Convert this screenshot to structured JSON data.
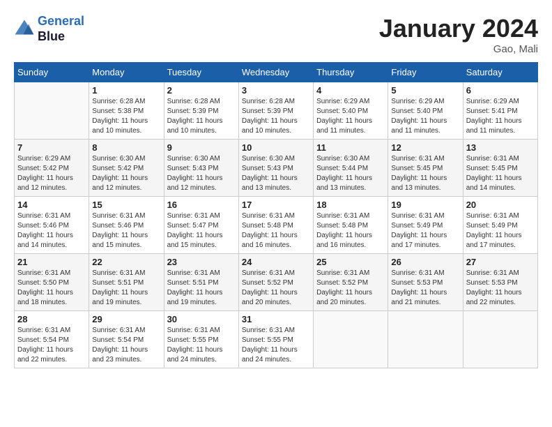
{
  "header": {
    "logo_line1": "General",
    "logo_line2": "Blue",
    "month_title": "January 2024",
    "location": "Gao, Mali"
  },
  "weekdays": [
    "Sunday",
    "Monday",
    "Tuesday",
    "Wednesday",
    "Thursday",
    "Friday",
    "Saturday"
  ],
  "weeks": [
    [
      {
        "day": "",
        "info": ""
      },
      {
        "day": "1",
        "info": "Sunrise: 6:28 AM\nSunset: 5:38 PM\nDaylight: 11 hours and 10 minutes."
      },
      {
        "day": "2",
        "info": "Sunrise: 6:28 AM\nSunset: 5:39 PM\nDaylight: 11 hours and 10 minutes."
      },
      {
        "day": "3",
        "info": "Sunrise: 6:28 AM\nSunset: 5:39 PM\nDaylight: 11 hours and 10 minutes."
      },
      {
        "day": "4",
        "info": "Sunrise: 6:29 AM\nSunset: 5:40 PM\nDaylight: 11 hours and 11 minutes."
      },
      {
        "day": "5",
        "info": "Sunrise: 6:29 AM\nSunset: 5:40 PM\nDaylight: 11 hours and 11 minutes."
      },
      {
        "day": "6",
        "info": "Sunrise: 6:29 AM\nSunset: 5:41 PM\nDaylight: 11 hours and 11 minutes."
      }
    ],
    [
      {
        "day": "7",
        "info": "Sunrise: 6:29 AM\nSunset: 5:42 PM\nDaylight: 11 hours and 12 minutes."
      },
      {
        "day": "8",
        "info": "Sunrise: 6:30 AM\nSunset: 5:42 PM\nDaylight: 11 hours and 12 minutes."
      },
      {
        "day": "9",
        "info": "Sunrise: 6:30 AM\nSunset: 5:43 PM\nDaylight: 11 hours and 12 minutes."
      },
      {
        "day": "10",
        "info": "Sunrise: 6:30 AM\nSunset: 5:43 PM\nDaylight: 11 hours and 13 minutes."
      },
      {
        "day": "11",
        "info": "Sunrise: 6:30 AM\nSunset: 5:44 PM\nDaylight: 11 hours and 13 minutes."
      },
      {
        "day": "12",
        "info": "Sunrise: 6:31 AM\nSunset: 5:45 PM\nDaylight: 11 hours and 13 minutes."
      },
      {
        "day": "13",
        "info": "Sunrise: 6:31 AM\nSunset: 5:45 PM\nDaylight: 11 hours and 14 minutes."
      }
    ],
    [
      {
        "day": "14",
        "info": "Sunrise: 6:31 AM\nSunset: 5:46 PM\nDaylight: 11 hours and 14 minutes."
      },
      {
        "day": "15",
        "info": "Sunrise: 6:31 AM\nSunset: 5:46 PM\nDaylight: 11 hours and 15 minutes."
      },
      {
        "day": "16",
        "info": "Sunrise: 6:31 AM\nSunset: 5:47 PM\nDaylight: 11 hours and 15 minutes."
      },
      {
        "day": "17",
        "info": "Sunrise: 6:31 AM\nSunset: 5:48 PM\nDaylight: 11 hours and 16 minutes."
      },
      {
        "day": "18",
        "info": "Sunrise: 6:31 AM\nSunset: 5:48 PM\nDaylight: 11 hours and 16 minutes."
      },
      {
        "day": "19",
        "info": "Sunrise: 6:31 AM\nSunset: 5:49 PM\nDaylight: 11 hours and 17 minutes."
      },
      {
        "day": "20",
        "info": "Sunrise: 6:31 AM\nSunset: 5:49 PM\nDaylight: 11 hours and 17 minutes."
      }
    ],
    [
      {
        "day": "21",
        "info": "Sunrise: 6:31 AM\nSunset: 5:50 PM\nDaylight: 11 hours and 18 minutes."
      },
      {
        "day": "22",
        "info": "Sunrise: 6:31 AM\nSunset: 5:51 PM\nDaylight: 11 hours and 19 minutes."
      },
      {
        "day": "23",
        "info": "Sunrise: 6:31 AM\nSunset: 5:51 PM\nDaylight: 11 hours and 19 minutes."
      },
      {
        "day": "24",
        "info": "Sunrise: 6:31 AM\nSunset: 5:52 PM\nDaylight: 11 hours and 20 minutes."
      },
      {
        "day": "25",
        "info": "Sunrise: 6:31 AM\nSunset: 5:52 PM\nDaylight: 11 hours and 20 minutes."
      },
      {
        "day": "26",
        "info": "Sunrise: 6:31 AM\nSunset: 5:53 PM\nDaylight: 11 hours and 21 minutes."
      },
      {
        "day": "27",
        "info": "Sunrise: 6:31 AM\nSunset: 5:53 PM\nDaylight: 11 hours and 22 minutes."
      }
    ],
    [
      {
        "day": "28",
        "info": "Sunrise: 6:31 AM\nSunset: 5:54 PM\nDaylight: 11 hours and 22 minutes."
      },
      {
        "day": "29",
        "info": "Sunrise: 6:31 AM\nSunset: 5:54 PM\nDaylight: 11 hours and 23 minutes."
      },
      {
        "day": "30",
        "info": "Sunrise: 6:31 AM\nSunset: 5:55 PM\nDaylight: 11 hours and 24 minutes."
      },
      {
        "day": "31",
        "info": "Sunrise: 6:31 AM\nSunset: 5:55 PM\nDaylight: 11 hours and 24 minutes."
      },
      {
        "day": "",
        "info": ""
      },
      {
        "day": "",
        "info": ""
      },
      {
        "day": "",
        "info": ""
      }
    ]
  ]
}
